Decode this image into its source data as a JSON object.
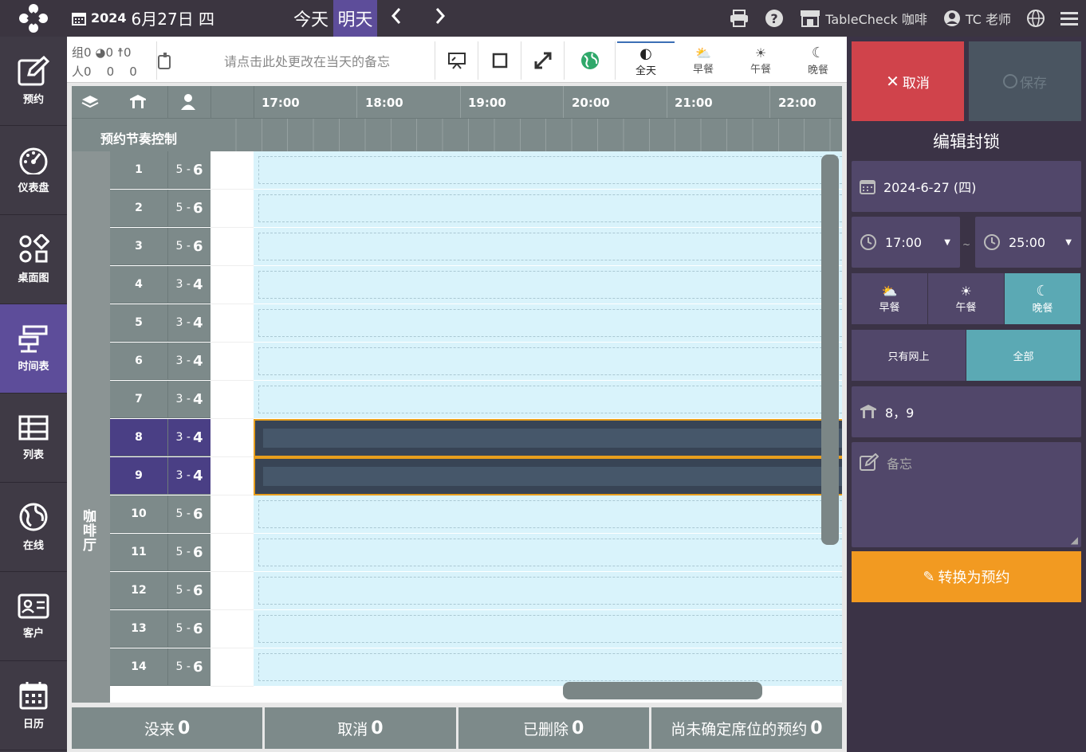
{
  "header": {
    "year": "2024",
    "date": "6月27日 四",
    "today": "今天",
    "tomorrow": "明天",
    "store": "TableCheck 咖啡",
    "user": "TC 老师"
  },
  "sidebar": [
    {
      "label": "预约",
      "icon": "edit-icon"
    },
    {
      "label": "仪表盘",
      "icon": "gauge-icon"
    },
    {
      "label": "桌面图",
      "icon": "shapes-icon"
    },
    {
      "label": "时间表",
      "icon": "timeline-icon",
      "active": true
    },
    {
      "label": "列表",
      "icon": "table-icon"
    },
    {
      "label": "在线",
      "icon": "globe-icon"
    },
    {
      "label": "客户",
      "icon": "id-card-icon"
    },
    {
      "label": "日历",
      "icon": "calendar-icon"
    }
  ],
  "counts": {
    "group_label": "组",
    "group_val": "0",
    "web_val": "0",
    "walk_val": "0",
    "people_label": "人",
    "people_val": "0",
    "people_web": "0",
    "people_walk": "0"
  },
  "memo_placeholder": "请点击此处更改在当天的备忘",
  "meals": [
    {
      "label": "全天",
      "active": true
    },
    {
      "label": "早餐"
    },
    {
      "label": "午餐"
    },
    {
      "label": "晚餐"
    }
  ],
  "grid": {
    "pace_label": "预约节奏控制",
    "area": "咖啡厅",
    "times": [
      "17:00",
      "18:00",
      "19:00",
      "20:00",
      "21:00",
      "22:00"
    ],
    "rows": [
      {
        "n": "1",
        "min": "5",
        "max": "6"
      },
      {
        "n": "2",
        "min": "5",
        "max": "6"
      },
      {
        "n": "3",
        "min": "5",
        "max": "6"
      },
      {
        "n": "4",
        "min": "3",
        "max": "4"
      },
      {
        "n": "5",
        "min": "3",
        "max": "4"
      },
      {
        "n": "6",
        "min": "3",
        "max": "4"
      },
      {
        "n": "7",
        "min": "3",
        "max": "4"
      },
      {
        "n": "8",
        "min": "3",
        "max": "4",
        "sel": true
      },
      {
        "n": "9",
        "min": "3",
        "max": "4",
        "sel": true
      },
      {
        "n": "10",
        "min": "5",
        "max": "6"
      },
      {
        "n": "11",
        "min": "5",
        "max": "6"
      },
      {
        "n": "12",
        "min": "5",
        "max": "6"
      },
      {
        "n": "13",
        "min": "5",
        "max": "6"
      },
      {
        "n": "14",
        "min": "5",
        "max": "6"
      }
    ]
  },
  "footer": [
    {
      "label": "没来",
      "val": "0"
    },
    {
      "label": "取消",
      "val": "0"
    },
    {
      "label": "已删除",
      "val": "0"
    },
    {
      "label": "尚未确定席位的预约",
      "val": "0"
    }
  ],
  "panel": {
    "cancel": "取消",
    "save": "保存",
    "title": "编辑封锁",
    "date": "2024-6-27 (四)",
    "start": "17:00",
    "sep": "~",
    "end": "25:00",
    "meals": [
      {
        "label": "早餐"
      },
      {
        "label": "午餐"
      },
      {
        "label": "晚餐",
        "active": true
      }
    ],
    "filter": [
      {
        "label": "只有网上"
      },
      {
        "label": "全部",
        "active": true
      }
    ],
    "tables": "8，9",
    "memo_placeholder": "备忘",
    "convert": "转换为预约"
  }
}
